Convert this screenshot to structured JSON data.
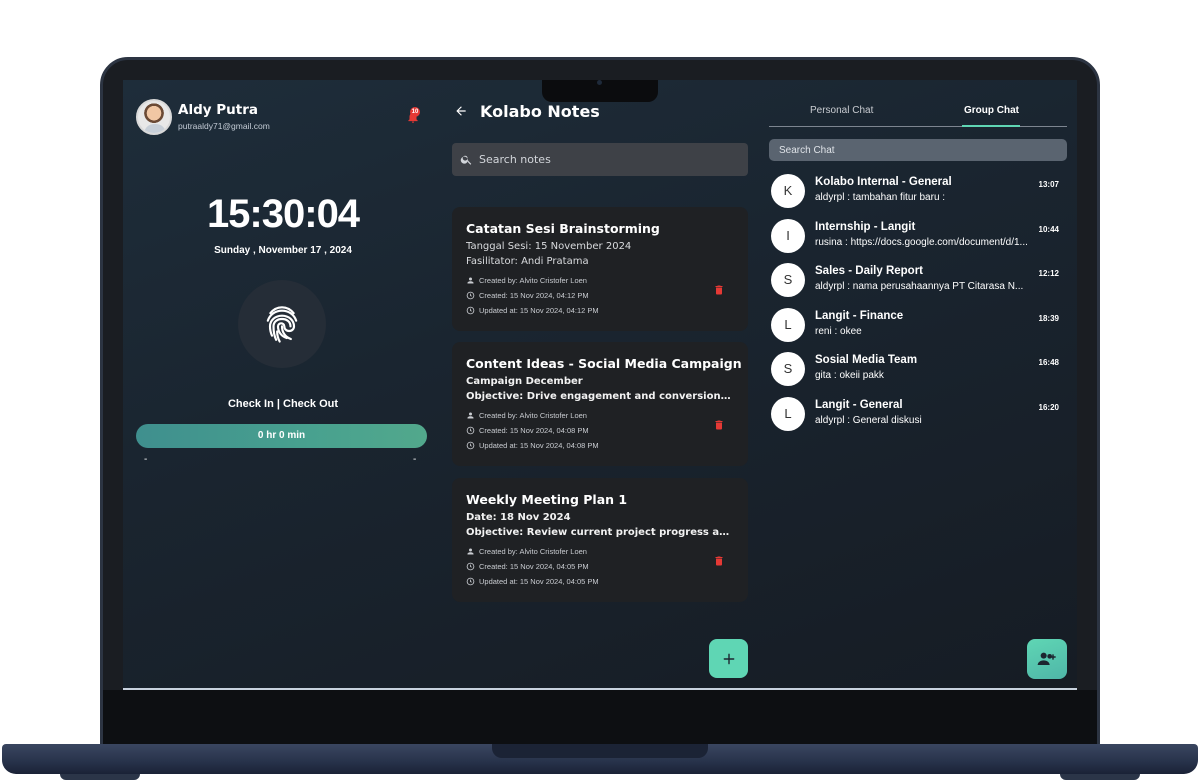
{
  "profile": {
    "name": "Aldy Putra",
    "email": "putraaldy71@gmail.com",
    "notification_count": "10"
  },
  "attendance": {
    "time": "15:30:04",
    "date": "Sunday , November 17 , 2024",
    "checkin_label": "Check In | Check Out",
    "duration": "0 hr 0 min",
    "checkin_time": "-",
    "checkout_time": "-"
  },
  "notes": {
    "title": "Kolabo Notes",
    "search_placeholder": "Search notes",
    "items": [
      {
        "title": "Catatan Sesi Brainstorming",
        "line1": "Tanggal Sesi: 15 November 2024",
        "line2": "Fasilitator: Andi Pratama",
        "created_by": "Created by: Alvito Cristofer Loen",
        "created": "Created: 15 Nov 2024, 04:12 PM",
        "updated": "Updated at: 15 Nov 2024, 04:12 PM"
      },
      {
        "title": "Content Ideas - Social Media Campaign",
        "line1": "Campaign December",
        "line2": "Objective: Drive engagement and conversions through targeted content",
        "created_by": "Created by: Alvito Cristofer Loen",
        "created": "Created: 15 Nov 2024, 04:08 PM",
        "updated": "Updated at: 15 Nov 2024, 04:08 PM"
      },
      {
        "title": "Weekly Meeting Plan 1",
        "line1": "Date: 18 Nov 2024",
        "line2": "Objective: Review current project progress and set priorities",
        "created_by": "Created by: Alvito Cristofer Loen",
        "created": "Created: 15 Nov 2024, 04:05 PM",
        "updated": "Updated at: 15 Nov 2024, 04:05 PM"
      }
    ]
  },
  "chat": {
    "tabs": [
      "Personal Chat",
      "Group Chat"
    ],
    "active_tab": "Group Chat",
    "search_placeholder": "Search Chat",
    "items": [
      {
        "initial": "K",
        "name": "Kolabo Internal - General",
        "message": "aldyrpl : tambahan fitur baru :",
        "time": "13:07"
      },
      {
        "initial": "I",
        "name": "Internship - Langit",
        "message": "rusina : https://docs.google.com/document/d/1...",
        "time": "10:44"
      },
      {
        "initial": "S",
        "name": "Sales - Daily Report",
        "message": "aldyrpl : nama perusahaannya PT Citarasa N...",
        "time": "12:12"
      },
      {
        "initial": "L",
        "name": "Langit - Finance",
        "message": "reni : okee",
        "time": "18:39"
      },
      {
        "initial": "S",
        "name": "Sosial Media Team",
        "message": "gita : okeii pakk",
        "time": "16:48"
      },
      {
        "initial": "L",
        "name": "Langit - General",
        "message": "aldyrpl : General diskusi",
        "time": "16:20"
      }
    ]
  },
  "colors": {
    "accent": "#5fd6b4",
    "danger": "#e53935",
    "card": "#1f2124"
  }
}
